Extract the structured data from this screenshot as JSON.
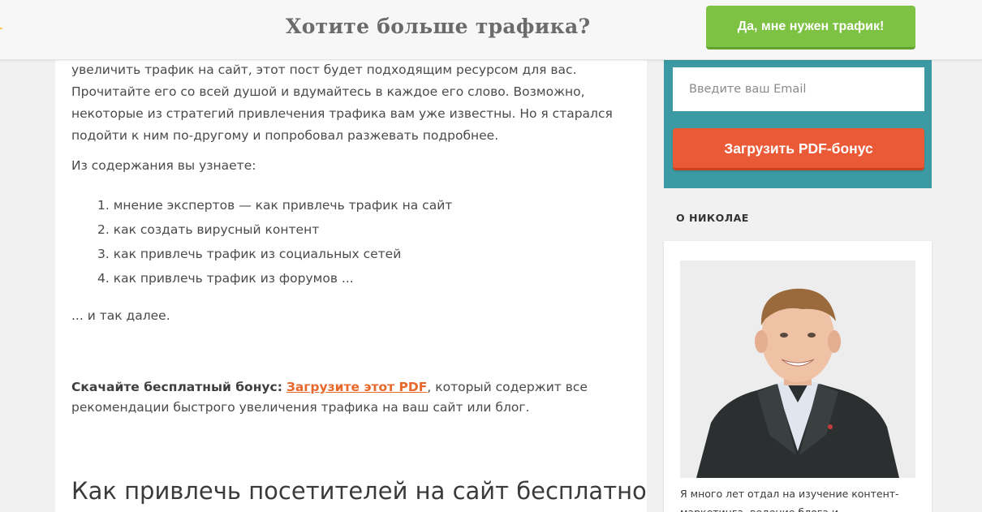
{
  "header": {
    "title": "Хотите больше трафика?",
    "cta_label": "Да, мне нужен трафик!"
  },
  "article": {
    "intro": "увеличить трафик на сайт, этот пост будет подходящим ресурсом для вас. Прочитайте его со всей душой и вдумайтесь в каждое его слово. Возможно, некоторые из стратегий привлечения трафика вам уже известны. Но я старался подойти к ним по-другому и попробовал разжевать подробнее.",
    "contents_lead": "Из содержания вы узнаете:",
    "contents_items": [
      "1. мнение экспертов — как привлечь трафик на сайт",
      "2. как создать вирусный контент",
      "3. как привлечь трафик из социальных сетей",
      "4. как привлечь трафик из форумов ..."
    ],
    "etc": "... и так далее.",
    "bonus_label": "Скачайте бесплатный бонус:",
    "bonus_link": "Загрузите этот PDF",
    "bonus_rest": ", который содержит все рекомендации быстрого увеличения трафика на ваш сайт или блог.",
    "heading": "Как привлечь посетителей на сайт бесплатно"
  },
  "sidebar": {
    "optin": {
      "email_placeholder": "Введите ваш Email",
      "button_label": "Загрузить PDF-бонус"
    },
    "about": {
      "heading": "О НИКОЛАЕ",
      "bio": "Я много лет отдал на изучение контент-маркетинга, ведение блога и"
    }
  },
  "colors": {
    "green_cta": "#7dc242",
    "teal_box": "#3b9aa3",
    "orange_button": "#ea5a36",
    "link_orange": "#e8672b"
  }
}
